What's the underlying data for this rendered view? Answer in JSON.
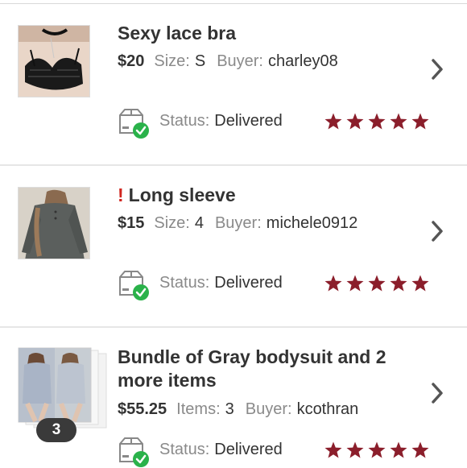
{
  "colors": {
    "star": "#8b1e2b",
    "check": "#2ab24a",
    "alert": "#d0261f"
  },
  "orders": [
    {
      "title": "Sexy lace bra",
      "price": "$20",
      "size_label": "Size:",
      "size_value": "S",
      "buyer_label": "Buyer:",
      "buyer_value": "charley08",
      "status_label": "Status:",
      "status_value": "Delivered",
      "rating": 5,
      "icon": "lace-bra-photo"
    },
    {
      "title": "Long sleeve",
      "alert": "!",
      "price": "$15",
      "size_label": "Size:",
      "size_value": "4",
      "buyer_label": "Buyer:",
      "buyer_value": "michele0912",
      "status_label": "Status:",
      "status_value": "Delivered",
      "rating": 5,
      "icon": "long-sleeve-photo"
    },
    {
      "title": "Bundle of Gray bodysuit and 2 more items",
      "price": "$55.25",
      "items_label": "Items:",
      "items_value": "3",
      "buyer_label": "Buyer:",
      "buyer_value": "kcothran",
      "status_label": "Status:",
      "status_value": "Delivered",
      "rating": 5,
      "bundle_count": "3",
      "icon": "bundle-photo"
    }
  ]
}
